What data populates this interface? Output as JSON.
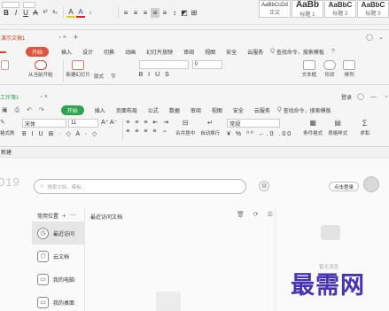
{
  "colors": {
    "accent": "#e0533d",
    "ppt_accent": "#d24726",
    "et_accent": "#2fa44f",
    "watermark": "#4634b4"
  },
  "writer": {
    "row1": {
      "font_size": "小四",
      "tab_label": ""
    },
    "format_icons": [
      "B",
      "I",
      "U",
      "A",
      "x²",
      "x₂",
      "A",
      "A"
    ],
    "styles": [
      {
        "preview": "AaBbCcDd",
        "name": "正文"
      },
      {
        "preview": "AaBb",
        "name": "标题 1"
      },
      {
        "preview": "AaBbC",
        "name": "标题 2"
      },
      {
        "preview": "AaBbC",
        "name": "标题 3"
      }
    ]
  },
  "ppt": {
    "doc_tab": "演示文稿1",
    "new_tab": "+",
    "start_button": "开始",
    "menu": [
      "插入",
      "设计",
      "切换",
      "动画",
      "幻灯片放映",
      "审阅",
      "视图",
      "安全",
      "云服务"
    ],
    "search": "查找命令、搜索模板",
    "ribbon": {
      "play_from_start": "从当前开始",
      "new_slide": "新建幻灯片",
      "layout": "版式",
      "section": "节",
      "font_size": "0",
      "textbox": "文本框",
      "shape": "形状",
      "arrange": "排列"
    }
  },
  "et": {
    "doc_tab": "工作簿1",
    "login": "登录",
    "start_button": "开始",
    "menu": [
      "插入",
      "页面布局",
      "公式",
      "数据",
      "审阅",
      "视图",
      "安全",
      "云服务"
    ],
    "search": "查找命令、搜索模板",
    "ribbon": {
      "format_painter": "格式刷",
      "font": "宋体",
      "font_size": "11",
      "number_format": "常规",
      "merge_center": "合并居中",
      "auto_wrap": "自动换行",
      "cond_format": "条件格式",
      "table_style": "表格样式",
      "sum": "求和"
    }
  },
  "home": {
    "title_tab": "新建",
    "year": "019",
    "search_placeholder": "搜索文档、模板...",
    "login_button": "点击登录",
    "sidebar_header": "常用位置",
    "sidebar": [
      "最近访问",
      "云文档",
      "我的电脑",
      "我的桌面"
    ],
    "section_title": "最近访问文档",
    "message": "暂无消息",
    "watermark": "最需网"
  }
}
